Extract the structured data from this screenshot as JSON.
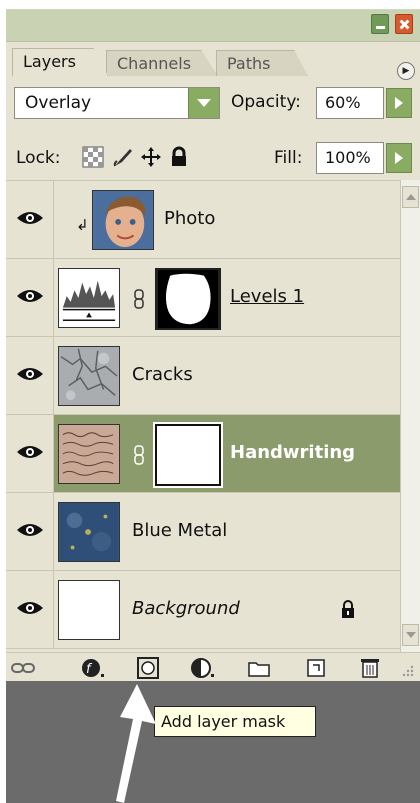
{
  "panel": {
    "tabs": [
      {
        "label": "Layers",
        "active": true
      },
      {
        "label": "Channels",
        "active": false
      },
      {
        "label": "Paths",
        "active": false
      }
    ],
    "menu_icon": "flyout-menu-icon"
  },
  "controls": {
    "blend_mode": "Overlay",
    "opacity_label": "Opacity:",
    "opacity_value": "60%",
    "lock_label": "Lock:",
    "fill_label": "Fill:",
    "fill_value": "100%"
  },
  "layers": [
    {
      "name": "Photo",
      "visible": true,
      "clipped": true,
      "thumbnail": "child-portrait"
    },
    {
      "name": "Levels 1",
      "visible": true,
      "adjustment": "levels-histogram",
      "has_mask": true
    },
    {
      "name": "Cracks",
      "visible": true,
      "thumbnail": "cracked-texture"
    },
    {
      "name": "Handwriting",
      "visible": true,
      "selected": true,
      "thumbnail": "handwriting-paper",
      "has_mask": true
    },
    {
      "name": "Blue Metal",
      "visible": true,
      "thumbnail": "blue-metal-texture"
    },
    {
      "name": "Background",
      "visible": true,
      "locked": true,
      "thumbnail": "white"
    }
  ],
  "bottom_icons": [
    "link-layers-icon",
    "layer-style-icon",
    "add-layer-mask-icon",
    "adjustment-layer-icon",
    "new-group-icon",
    "new-layer-icon",
    "trash-icon"
  ],
  "tooltip": "Add layer mask",
  "colors": {
    "panel_bg": "#e6e3d3",
    "titlebar": "#c9d3b3",
    "selected_row": "#8c9b6c",
    "button_green": "#8aab62",
    "close_red": "#d65a2e",
    "tooltip_bg": "#ffffe1"
  }
}
